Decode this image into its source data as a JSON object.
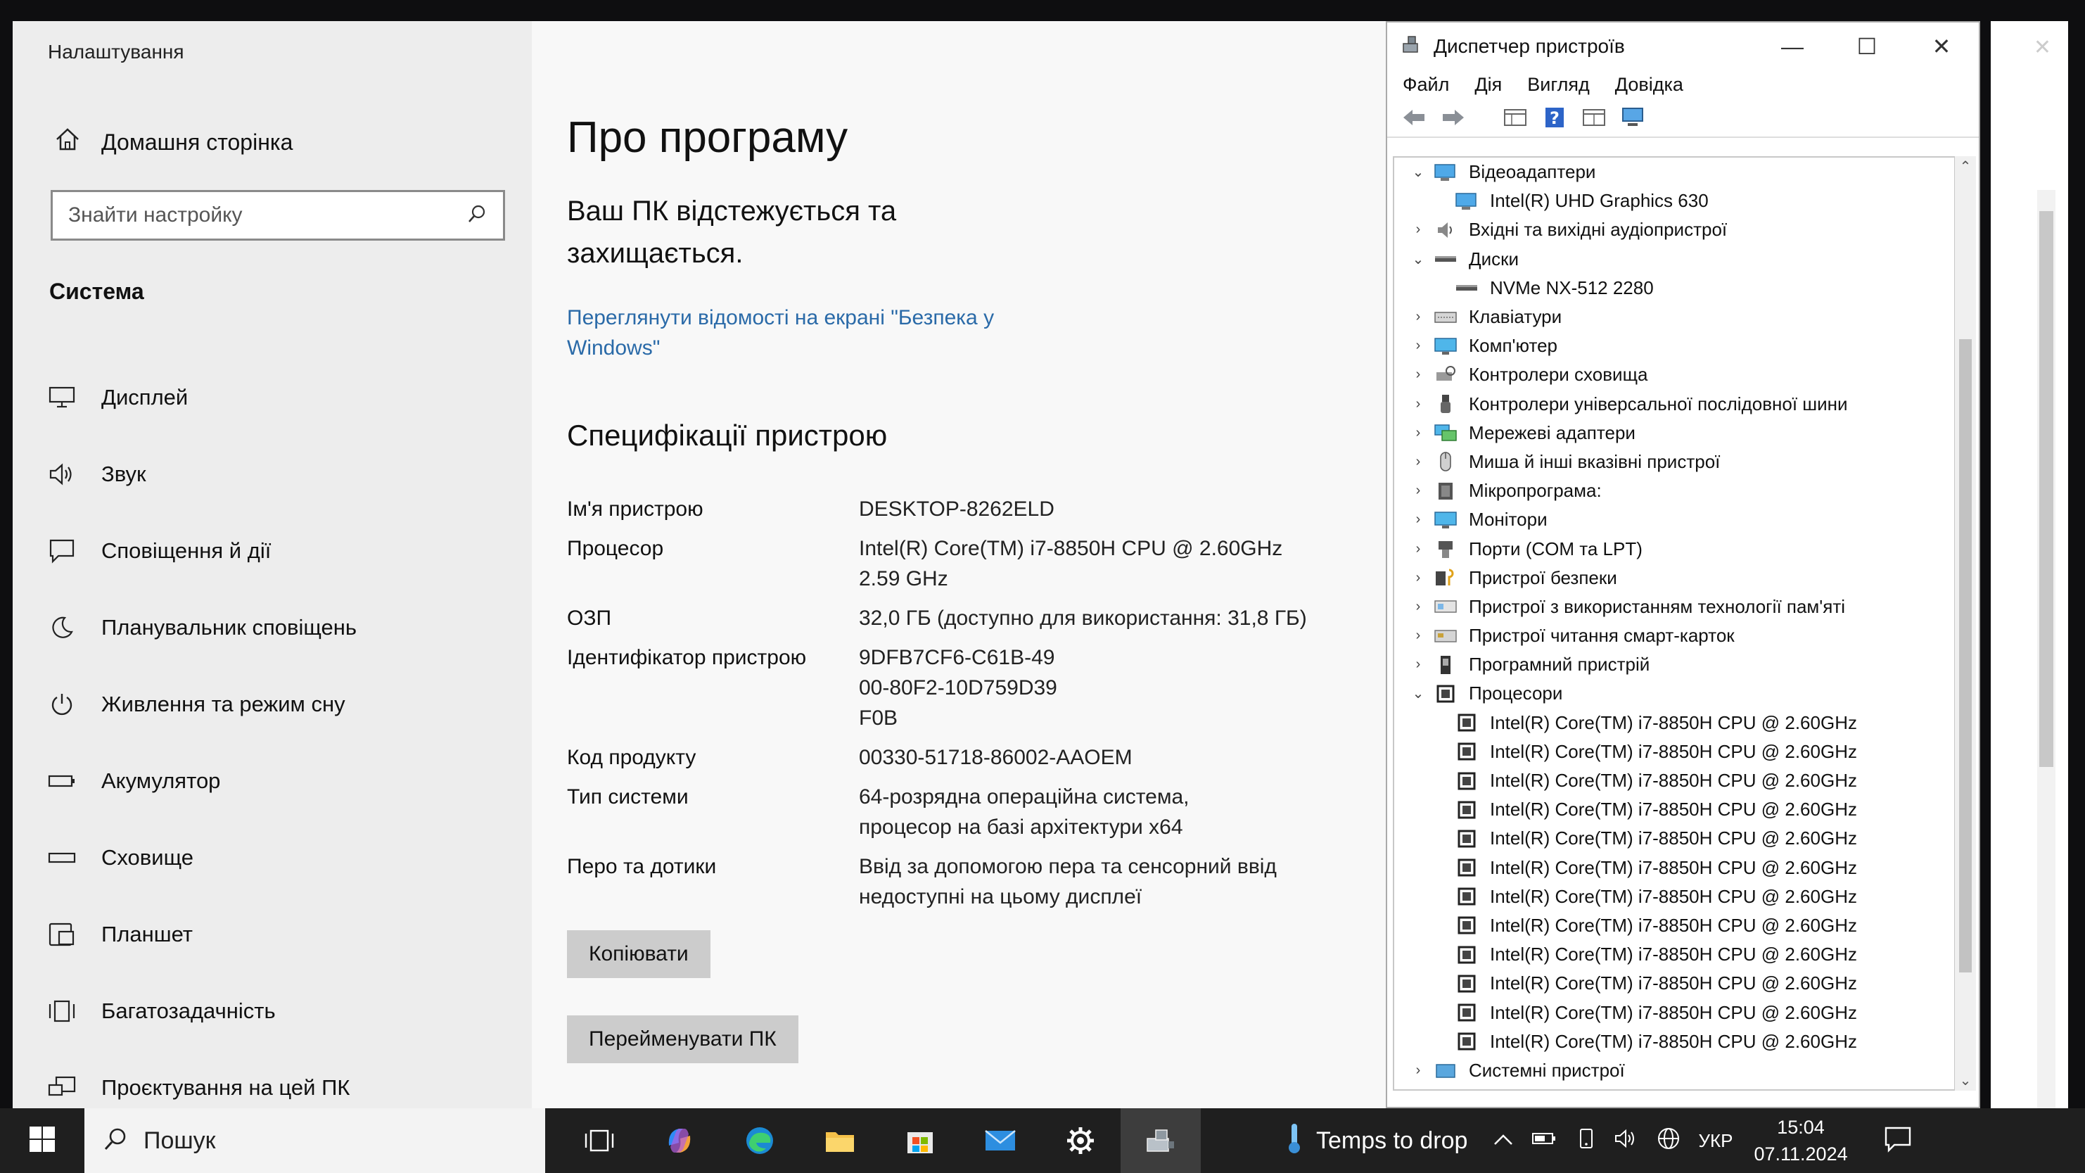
{
  "settings": {
    "app_title": "Налаштування",
    "home_label": "Домашня сторінка",
    "search_placeholder": "Знайти настройку",
    "section_label": "Система",
    "nav": [
      {
        "label": "Дисплей",
        "icon": "monitor-icon"
      },
      {
        "label": "Звук",
        "icon": "speaker-icon"
      },
      {
        "label": "Сповіщення й дії",
        "icon": "notification-icon"
      },
      {
        "label": "Планувальник сповіщень",
        "icon": "moon-icon"
      },
      {
        "label": "Живлення та режим сну",
        "icon": "power-icon"
      },
      {
        "label": "Акумулятор",
        "icon": "battery-icon"
      },
      {
        "label": "Сховище",
        "icon": "storage-icon"
      },
      {
        "label": "Планшет",
        "icon": "tablet-icon"
      },
      {
        "label": "Багатозадачність",
        "icon": "multitasking-icon"
      },
      {
        "label": "Проєктування на цей ПК",
        "icon": "project-icon"
      }
    ],
    "page_title": "Про програму",
    "protection_text": "Ваш ПК відстежується та захищається.",
    "security_link": "Переглянути відомості на екрані \"Безпека у Windows\"",
    "spec_title": "Специфікації пристрою",
    "specs": [
      {
        "key": "Ім'я пристрою",
        "value": "DESKTOP-8262ELD"
      },
      {
        "key": "Процесор",
        "value": "Intel(R) Core(TM) i7-8850H CPU @ 2.60GHz   2.59 GHz"
      },
      {
        "key": "ОЗП",
        "value": "32,0 ГБ (доступно для використання: 31,8 ГБ)"
      },
      {
        "key": "Ідентифікатор пристрою",
        "value": "9DFB7CF6-C61B-4900-80F2-10D759D39F0B"
      },
      {
        "key": "Код продукту",
        "value": "00330-51718-86002-AAOEM"
      },
      {
        "key": "Тип системи",
        "value": "64-розрядна операційна система, процесор на базі архітектури x64"
      },
      {
        "key": "Перо та дотики",
        "value": "Ввід за допомогою пера та сенсорний ввід недоступні на цьому дисплеї"
      }
    ],
    "copy_button": "Копіювати",
    "rename_button": "Перейменувати ПК"
  },
  "devmgr": {
    "title": "Диспетчер пристроїв",
    "menu": [
      "Файл",
      "Дія",
      "Вигляд",
      "Довідка"
    ],
    "tree": [
      {
        "label": "Відеоадаптери",
        "level": 0,
        "state": "expanded",
        "icon": "display-adapter-icon"
      },
      {
        "label": "Intel(R) UHD Graphics 630",
        "level": 1,
        "state": "leaf",
        "icon": "display-adapter-icon"
      },
      {
        "label": "Вхідні та вихідні аудіопристрої",
        "level": 0,
        "state": "collapsed",
        "icon": "audio-icon"
      },
      {
        "label": "Диски",
        "level": 0,
        "state": "expanded",
        "icon": "disk-icon"
      },
      {
        "label": "NVMe NX-512 2280",
        "level": 1,
        "state": "leaf",
        "icon": "disk-icon"
      },
      {
        "label": "Клавіатури",
        "level": 0,
        "state": "collapsed",
        "icon": "keyboard-icon"
      },
      {
        "label": "Комп'ютер",
        "level": 0,
        "state": "collapsed",
        "icon": "computer-icon"
      },
      {
        "label": "Контролери сховища",
        "level": 0,
        "state": "collapsed",
        "icon": "storage-controller-icon"
      },
      {
        "label": "Контролери універсальної послідовної шини",
        "level": 0,
        "state": "collapsed",
        "icon": "usb-icon"
      },
      {
        "label": "Мережеві адаптери",
        "level": 0,
        "state": "collapsed",
        "icon": "network-icon"
      },
      {
        "label": "Миша й інші вказівні пристрої",
        "level": 0,
        "state": "collapsed",
        "icon": "mouse-icon"
      },
      {
        "label": "Мікропрограма:",
        "level": 0,
        "state": "collapsed",
        "icon": "firmware-icon"
      },
      {
        "label": "Монітори",
        "level": 0,
        "state": "collapsed",
        "icon": "monitor-icon"
      },
      {
        "label": "Порти (COM та LPT)",
        "level": 0,
        "state": "collapsed",
        "icon": "port-icon"
      },
      {
        "label": "Пристрої безпеки",
        "level": 0,
        "state": "collapsed",
        "icon": "security-device-icon"
      },
      {
        "label": "Пристрої з використанням технології пам'яті",
        "level": 0,
        "state": "collapsed",
        "icon": "memory-icon"
      },
      {
        "label": "Пристрої читання смарт-карток",
        "level": 0,
        "state": "collapsed",
        "icon": "smartcard-icon"
      },
      {
        "label": "Програмний пристрій",
        "level": 0,
        "state": "collapsed",
        "icon": "software-device-icon"
      },
      {
        "label": "Процесори",
        "level": 0,
        "state": "expanded",
        "icon": "processor-icon"
      },
      {
        "label": "Intel(R) Core(TM) i7-8850H CPU @ 2.60GHz",
        "level": 1,
        "state": "leaf",
        "icon": "processor-icon"
      },
      {
        "label": "Intel(R) Core(TM) i7-8850H CPU @ 2.60GHz",
        "level": 1,
        "state": "leaf",
        "icon": "processor-icon"
      },
      {
        "label": "Intel(R) Core(TM) i7-8850H CPU @ 2.60GHz",
        "level": 1,
        "state": "leaf",
        "icon": "processor-icon"
      },
      {
        "label": "Intel(R) Core(TM) i7-8850H CPU @ 2.60GHz",
        "level": 1,
        "state": "leaf",
        "icon": "processor-icon"
      },
      {
        "label": "Intel(R) Core(TM) i7-8850H CPU @ 2.60GHz",
        "level": 1,
        "state": "leaf",
        "icon": "processor-icon"
      },
      {
        "label": "Intel(R) Core(TM) i7-8850H CPU @ 2.60GHz",
        "level": 1,
        "state": "leaf",
        "icon": "processor-icon"
      },
      {
        "label": "Intel(R) Core(TM) i7-8850H CPU @ 2.60GHz",
        "level": 1,
        "state": "leaf",
        "icon": "processor-icon"
      },
      {
        "label": "Intel(R) Core(TM) i7-8850H CPU @ 2.60GHz",
        "level": 1,
        "state": "leaf",
        "icon": "processor-icon"
      },
      {
        "label": "Intel(R) Core(TM) i7-8850H CPU @ 2.60GHz",
        "level": 1,
        "state": "leaf",
        "icon": "processor-icon"
      },
      {
        "label": "Intel(R) Core(TM) i7-8850H CPU @ 2.60GHz",
        "level": 1,
        "state": "leaf",
        "icon": "processor-icon"
      },
      {
        "label": "Intel(R) Core(TM) i7-8850H CPU @ 2.60GHz",
        "level": 1,
        "state": "leaf",
        "icon": "processor-icon"
      },
      {
        "label": "Intel(R) Core(TM) i7-8850H CPU @ 2.60GHz",
        "level": 1,
        "state": "leaf",
        "icon": "processor-icon"
      },
      {
        "label": "Системні пристрої",
        "level": 0,
        "state": "collapsed",
        "icon": "system-device-icon"
      }
    ]
  },
  "taskbar": {
    "search_placeholder": "Пошук",
    "apps": [
      "task-view-icon",
      "copilot-icon",
      "edge-icon",
      "file-explorer-icon",
      "store-icon",
      "mail-icon",
      "settings-gear-icon",
      "device-manager-icon"
    ],
    "weather_text": "Temps to drop",
    "language": "УКР",
    "time": "15:04",
    "date": "07.11.2024"
  },
  "colors": {
    "sidebar_bg": "#ededed",
    "link": "#2a6aa8",
    "taskbar_bg": "#1f1f1f",
    "accent_blue": "#2d7fd3"
  }
}
